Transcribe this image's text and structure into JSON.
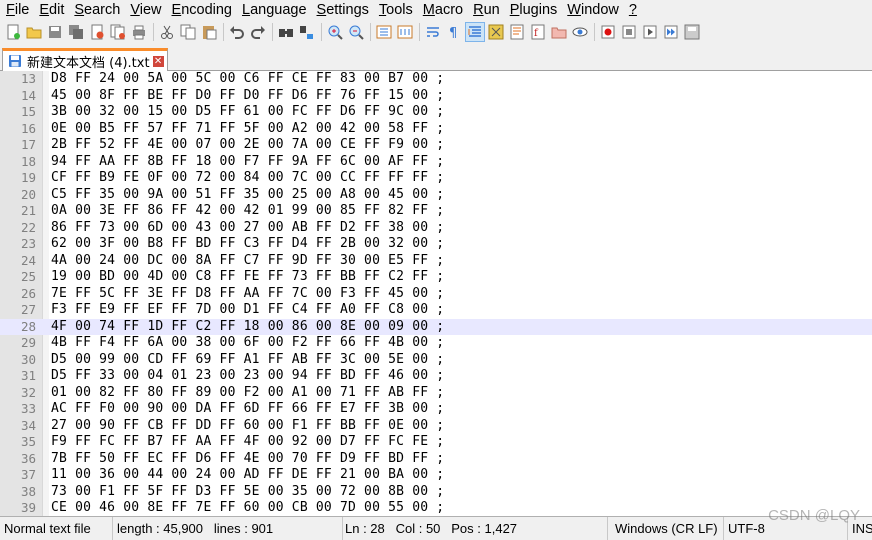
{
  "menu": [
    {
      "label": "File",
      "ul": "F",
      "rest": "ile"
    },
    {
      "label": "Edit",
      "ul": "E",
      "rest": "dit"
    },
    {
      "label": "Search",
      "ul": "S",
      "rest": "earch"
    },
    {
      "label": "View",
      "ul": "V",
      "rest": "iew"
    },
    {
      "label": "Encoding",
      "ul": "E",
      "rest": "ncoding"
    },
    {
      "label": "Language",
      "ul": "L",
      "rest": "anguage"
    },
    {
      "label": "Settings",
      "ul": "S",
      "rest": "ettings"
    },
    {
      "label": "Tools",
      "ul": "T",
      "rest": "ools"
    },
    {
      "label": "Macro",
      "ul": "M",
      "rest": "acro"
    },
    {
      "label": "Run",
      "ul": "R",
      "rest": "un"
    },
    {
      "label": "Plugins",
      "ul": "P",
      "rest": "lugins"
    },
    {
      "label": "Window",
      "ul": "W",
      "rest": "indow"
    },
    {
      "label": "?",
      "ul": "?",
      "rest": ""
    }
  ],
  "toolbar_icons": [
    "new-file-icon",
    "open-file-icon",
    "save-icon",
    "save-all-icon",
    "close-icon",
    "close-all-icon",
    "print-icon",
    "|",
    "cut-icon",
    "copy-icon",
    "paste-icon",
    "|",
    "undo-icon",
    "redo-icon",
    "|",
    "find-icon",
    "replace-icon",
    "|",
    "zoom-in-icon",
    "zoom-out-icon",
    "|",
    "sync-vertical-icon",
    "sync-horizontal-icon",
    "|",
    "word-wrap-icon",
    "show-all-characters-icon",
    "indent-guide-icon",
    "user-language-icon",
    "document-map-icon",
    "function-list-icon",
    "folder-workspace-icon",
    "monitoring-icon",
    "|",
    "record-macro-icon",
    "stop-recording-icon",
    "play-macro-icon",
    "run-macro-multiple-icon",
    "save-macro-icon"
  ],
  "tab": {
    "label": "新建文本文档 (4).txt"
  },
  "current_line": 28,
  "lines": [
    {
      "n": "13",
      "text": "D8 FF 24 00 5A 00 5C 00 C6 FF CE FF 83 00 B7 00 ;"
    },
    {
      "n": "14",
      "text": "45 00 8F FF BE FF D0 FF D0 FF D6 FF 76 FF 15 00 ;"
    },
    {
      "n": "15",
      "text": "3B 00 32 00 15 00 D5 FF 61 00 FC FF D6 FF 9C 00 ;"
    },
    {
      "n": "16",
      "text": "0E 00 B5 FF 57 FF 71 FF 5F 00 A2 00 42 00 58 FF ;"
    },
    {
      "n": "17",
      "text": "2B FF 52 FF 4E 00 07 00 2E 00 7A 00 CE FF F9 00 ;"
    },
    {
      "n": "18",
      "text": "94 FF AA FF 8B FF 18 00 F7 FF 9A FF 6C 00 AF FF ;"
    },
    {
      "n": "19",
      "text": "CF FF B9 FE 0F 00 72 00 84 00 7C 00 CC FF FF FF ;"
    },
    {
      "n": "20",
      "text": "C5 FF 35 00 9A 00 51 FF 35 00 25 00 A8 00 45 00 ;"
    },
    {
      "n": "21",
      "text": "0A 00 3E FF 86 FF 42 00 42 01 99 00 85 FF 82 FF ;"
    },
    {
      "n": "22",
      "text": "86 FF 73 00 6D 00 43 00 27 00 AB FF D2 FF 38 00 ;"
    },
    {
      "n": "23",
      "text": "62 00 3F 00 B8 FF BD FF C3 FF D4 FF 2B 00 32 00 ;"
    },
    {
      "n": "24",
      "text": "4A 00 24 00 DC 00 8A FF C7 FF 9D FF 30 00 E5 FF ;"
    },
    {
      "n": "25",
      "text": "19 00 BD 00 4D 00 C8 FF FE FF 73 FF BB FF C2 FF ;"
    },
    {
      "n": "26",
      "text": "7E FF 5C FF 3E FF D8 FF AA FF 7C 00 F3 FF 45 00 ;"
    },
    {
      "n": "27",
      "text": "F3 FF E9 FF EF FF 7D 00 D1 FF C4 FF A0 FF C8 00 ;"
    },
    {
      "n": "28",
      "text": "4F 00 74 FF 1D FF C2 FF 18 00 86 00 8E 00 09 00 ;"
    },
    {
      "n": "29",
      "text": "4B FF F4 FF 6A 00 38 00 6F 00 F2 FF 66 FF 4B 00 ;"
    },
    {
      "n": "30",
      "text": "D5 00 99 00 CD FF 69 FF A1 FF AB FF 3C 00 5E 00 ;"
    },
    {
      "n": "31",
      "text": "D5 FF 33 00 04 01 23 00 23 00 94 FF BD FF 46 00 ;"
    },
    {
      "n": "32",
      "text": "01 00 82 FF 80 FF 89 00 F2 00 A1 00 71 FF AB FF ;"
    },
    {
      "n": "33",
      "text": "AC FF F0 00 90 00 DA FF 6D FF 66 FF E7 FF 3B 00 ;"
    },
    {
      "n": "34",
      "text": "27 00 90 FF CB FF DD FF 60 00 F1 FF BB FF 0E 00 ;"
    },
    {
      "n": "35",
      "text": "F9 FF FC FF B7 FF AA FF 4F 00 92 00 D7 FF FC FE ;"
    },
    {
      "n": "36",
      "text": "7B FF 50 FF EC FF D6 FF 4E 00 70 FF D9 FF BD FF ;"
    },
    {
      "n": "37",
      "text": "11 00 36 00 44 00 24 00 AD FF DE FF 21 00 BA 00 ;"
    },
    {
      "n": "38",
      "text": "73 00 F1 FF 5F FF D3 FF 5E 00 35 00 72 00 8B 00 ;"
    },
    {
      "n": "39",
      "text": "CE 00 46 00 8E FF 7E FF 60 00 CB 00 7D 00 55 00 ;"
    }
  ],
  "status": {
    "file_type": "Normal text file",
    "length": "length : 45,900",
    "lines": "lines : 901",
    "ln": "Ln : 28",
    "col": "Col : 50",
    "pos": "Pos : 1,427",
    "eol": "Windows (CR LF)",
    "encoding": "UTF-8",
    "mode": "INS"
  },
  "watermark": "CSDN @LQY"
}
